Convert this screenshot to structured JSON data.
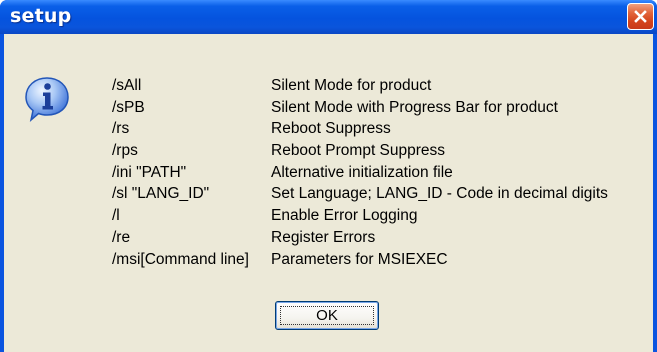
{
  "window": {
    "title": "setup",
    "close_icon": "close-icon",
    "message_icon": "info-icon",
    "colors": {
      "titlebar": "#0a55dc",
      "client_bg": "#ece9d8",
      "close_button": "#d4441c",
      "info_icon": "#2f6ee0"
    }
  },
  "message": {
    "rows": [
      {
        "switch": "/sAll",
        "description": "Silent Mode for product"
      },
      {
        "switch": "/sPB",
        "description": "Silent Mode with Progress Bar for product"
      },
      {
        "switch": "/rs",
        "description": "Reboot Suppress"
      },
      {
        "switch": "/rps",
        "description": "Reboot Prompt Suppress"
      },
      {
        "switch": "/ini \"PATH\"",
        "description": "Alternative initialization file"
      },
      {
        "switch": "/sl \"LANG_ID\"",
        "description": "Set Language; LANG_ID - Code in decimal digits"
      },
      {
        "switch": "/l",
        "description": "Enable Error Logging"
      },
      {
        "switch": "/re",
        "description": "Register Errors"
      },
      {
        "switch": "/msi[Command line]",
        "description": "Parameters for MSIEXEC"
      }
    ]
  },
  "buttons": {
    "ok_label": "OK"
  }
}
